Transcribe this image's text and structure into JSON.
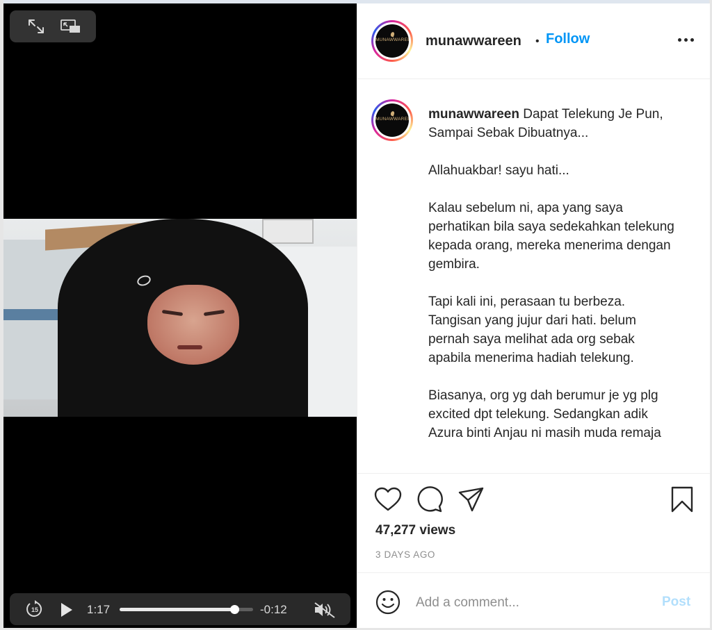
{
  "video": {
    "controls_top": {
      "expand_icon": "expand-arrows-icon",
      "pip_icon": "picture-in-picture-icon"
    },
    "controls_bottom": {
      "skip_back_label": "15",
      "elapsed": "1:17",
      "remaining": "-0:12",
      "progress_fraction": 0.86,
      "play_icon": "play-icon",
      "mute_icon": "speaker-muted-icon"
    }
  },
  "header": {
    "username": "munawwareen",
    "separator": "•",
    "follow_label": "Follow",
    "avatar_text": "MUNAWWAREEN"
  },
  "caption": {
    "username": "munawwareen",
    "title": "Dapat Telekung Je Pun, Sampai Sebak Dibuatnya...",
    "paragraphs": [
      "Allahuakbar! sayu hati...",
      "Kalau sebelum ni, apa yang saya perhatikan bila saya sedekahkan telekung kepada orang, mereka menerima dengan gembira.",
      "Tapi kali ini, perasaan tu berbeza. Tangisan yang jujur dari hati. belum pernah saya melihat ada org sebak apabila menerima hadiah telekung.",
      "Biasanya, org yg dah berumur je yg plg excited dpt telekung. Sedangkan adik Azura binti Anjau ni masih muda remaja"
    ]
  },
  "stats": {
    "views": "47,277 views",
    "posted": "3 DAYS AGO"
  },
  "comment": {
    "placeholder": "Add a comment...",
    "post_label": "Post"
  },
  "colors": {
    "accent": "#0095f6",
    "post_disabled": "#b2dffc",
    "text": "#262626",
    "muted": "#8e8e8e"
  }
}
